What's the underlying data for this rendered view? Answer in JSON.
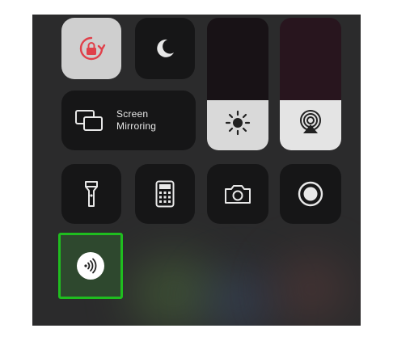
{
  "screen_mirroring": {
    "label_line1": "Screen",
    "label_line2": "Mirroring"
  },
  "brightness": {
    "level": 0.38
  },
  "volume": {
    "level": 0.38
  },
  "icons": [
    "rotation-lock-icon",
    "do-not-disturb-icon",
    "screen-mirroring-icon",
    "brightness-icon",
    "airplay-audio-icon",
    "flashlight-icon",
    "calculator-icon",
    "camera-icon",
    "screen-record-icon",
    "nfc-icon"
  ],
  "colors": {
    "background": "#2b2b2c",
    "tile_dark": "#141415",
    "tile_light": "#cfcfcf",
    "rotation_lock_red": "#e0404a",
    "highlight_green": "#1fbd1f"
  }
}
